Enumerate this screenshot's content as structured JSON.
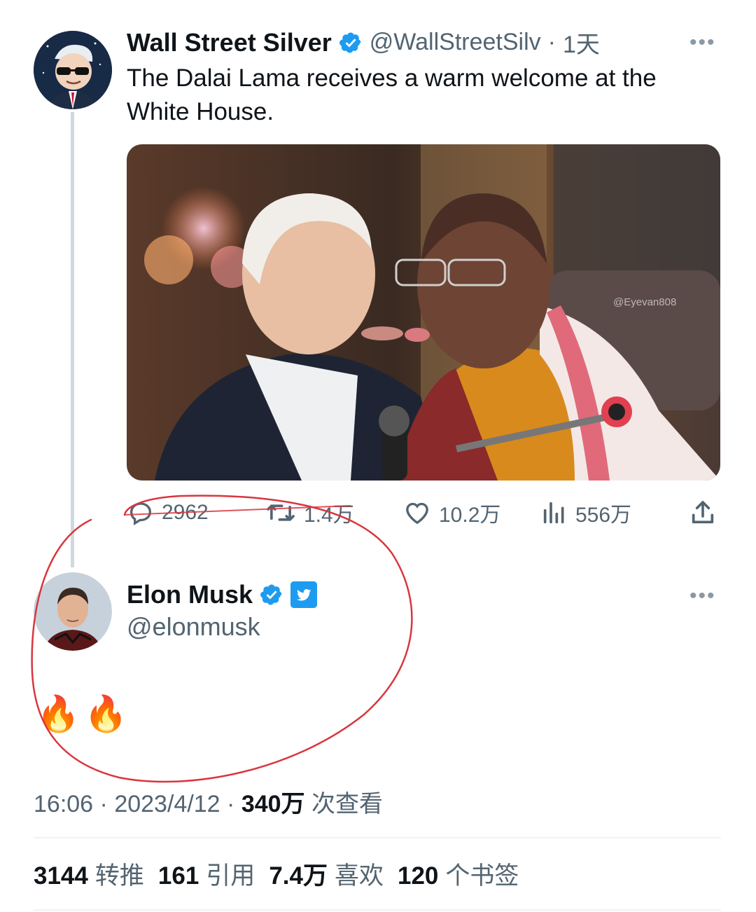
{
  "tweet": {
    "author_name": "Wall Street Silver",
    "handle": "@WallStreetSilv",
    "separator": "·",
    "time_ago": "1天",
    "text": "The Dalai Lama receives a warm welcome at the White House.",
    "photo_watermark": "@Eyevan808",
    "actions": {
      "replies": "2962",
      "retweets": "1.4万",
      "likes": "10.2万",
      "views": "556万"
    }
  },
  "reply": {
    "author_name": "Elon Musk",
    "handle": "@elonmusk",
    "text": "🔥🔥",
    "time": "16:06",
    "date": "2023/4/12",
    "separator": "·",
    "view_count": "340万",
    "view_label": "次查看"
  },
  "stats": {
    "retweets_count": "3144",
    "retweets_label": "转推",
    "quotes_count": "161",
    "quotes_label": "引用",
    "likes_count": "7.4万",
    "likes_label": "喜欢",
    "bookmarks_count": "120",
    "bookmarks_label": "个书签"
  },
  "colors": {
    "verified_blue": "#1d9bf0",
    "muted_text": "#536471",
    "annotation_red": "#d9363e"
  },
  "icons": [
    "verified-badge-icon",
    "twitter-bird-icon",
    "reply-icon",
    "retweet-icon",
    "like-icon",
    "views-icon",
    "share-icon",
    "more-icon"
  ]
}
